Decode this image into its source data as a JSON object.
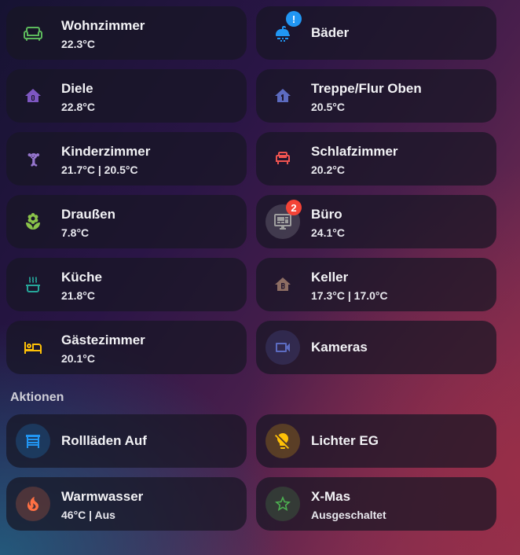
{
  "colors": {
    "green": "#5cb85c",
    "blue": "#2196f3",
    "purple": "#7e57c2",
    "indigo": "#5c6bc0",
    "lavender": "#9575cd",
    "red": "#ef5350",
    "lime": "#8bc34a",
    "teal": "#26a69a",
    "brown": "#8d6e63",
    "amber": "#ffc107",
    "orange": "#ff7043",
    "star_green": "#4caf50",
    "badge_blue": "#2196f3",
    "badge_red": "#f44336"
  },
  "rooms": [
    {
      "name": "Wohnzimmer",
      "temp": "22.3°C",
      "icon": "sofa-icon"
    },
    {
      "name": "Bäder",
      "icon": "shower-icon",
      "badge": "!"
    },
    {
      "name": "Diele",
      "temp": "22.8°C",
      "icon": "home-floor-0-icon"
    },
    {
      "name": "Treppe/Flur Oben",
      "temp": "20.5°C",
      "icon": "home-floor-1-icon"
    },
    {
      "name": "Kinderzimmer",
      "temp": "21.7°C | 20.5°C",
      "icon": "teddy-bear-icon"
    },
    {
      "name": "Schlafzimmer",
      "temp": "20.2°C",
      "icon": "bed-icon"
    },
    {
      "name": "Draußen",
      "temp": "7.8°C",
      "icon": "flower-icon"
    },
    {
      "name": "Büro",
      "temp": "24.1°C",
      "icon": "monitor-dashboard-icon",
      "badge": "2"
    },
    {
      "name": "Küche",
      "temp": "21.8°C",
      "icon": "pot-steam-icon"
    },
    {
      "name": "Keller",
      "temp": "17.3°C | 17.0°C",
      "icon": "home-floor-b-icon"
    },
    {
      "name": "Gästezimmer",
      "temp": "20.1°C",
      "icon": "bed-outline-icon"
    },
    {
      "name": "Kameras",
      "icon": "video-camera-icon"
    }
  ],
  "section": {
    "actions_title": "Aktionen"
  },
  "actions": [
    {
      "name": "Rollläden Auf",
      "icon": "window-shutter-open-icon"
    },
    {
      "name": "Lichter EG",
      "icon": "lightbulb-off-icon"
    },
    {
      "name": "Warmwasser",
      "status": "46°C | Aus",
      "icon": "fire-icon"
    },
    {
      "name": "X-Mas",
      "status": "Ausgeschaltet",
      "icon": "star-outline-icon"
    }
  ]
}
